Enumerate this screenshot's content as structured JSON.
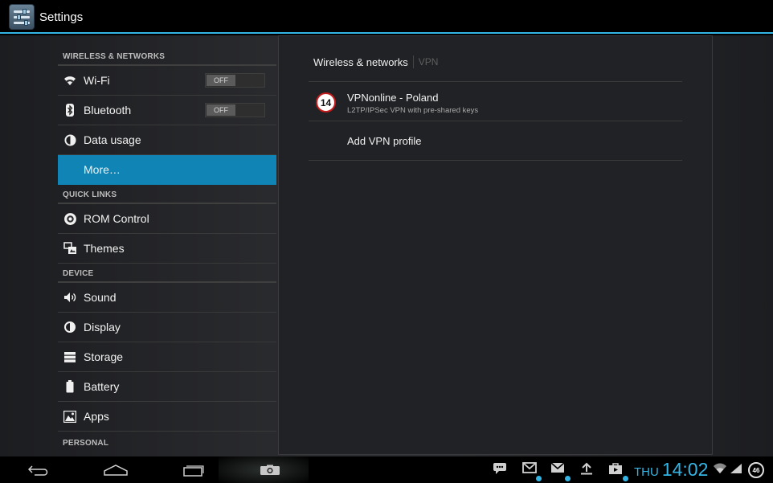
{
  "app": {
    "title": "Settings"
  },
  "nav": {
    "sections": {
      "wireless": "WIRELESS & NETWORKS",
      "quick_links": "QUICK LINKS",
      "device": "DEVICE",
      "personal": "PERSONAL"
    },
    "items": {
      "wifi": {
        "label": "Wi-Fi",
        "toggle": "OFF",
        "icon": "wifi-icon"
      },
      "bluetooth": {
        "label": "Bluetooth",
        "toggle": "OFF",
        "icon": "bluetooth-icon"
      },
      "data_usage": {
        "label": "Data usage",
        "icon": "data-usage-icon"
      },
      "more": {
        "label": "More…"
      },
      "rom_control": {
        "label": "ROM Control",
        "icon": "rom-control-icon"
      },
      "themes": {
        "label": "Themes",
        "icon": "themes-icon"
      },
      "sound": {
        "label": "Sound",
        "icon": "sound-icon"
      },
      "display": {
        "label": "Display",
        "icon": "display-icon"
      },
      "storage": {
        "label": "Storage",
        "icon": "storage-icon"
      },
      "battery": {
        "label": "Battery",
        "icon": "battery-icon"
      },
      "apps": {
        "label": "Apps",
        "icon": "apps-icon"
      }
    }
  },
  "panel": {
    "breadcrumb": {
      "main": "Wireless & networks",
      "sub": "VPN"
    },
    "vpn_profiles": [
      {
        "badge": "14",
        "name": "VPNonline - Poland",
        "description": "L2TP/IPSec VPN with pre-shared keys"
      }
    ],
    "add_profile_label": "Add VPN profile"
  },
  "statusbar": {
    "day": "THU",
    "time": "14:02",
    "battery_level": "46"
  },
  "colors": {
    "accent": "#33b5e5",
    "selected": "#0f84b5",
    "badge_border": "#c21b1b"
  }
}
